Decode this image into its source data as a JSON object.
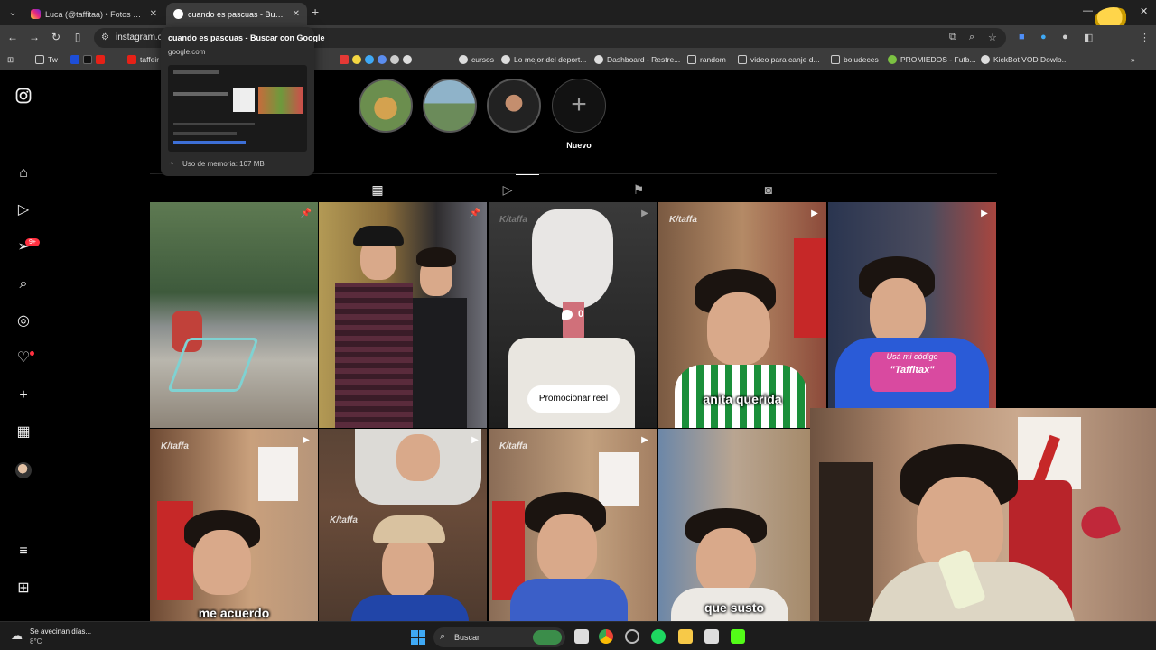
{
  "browser": {
    "tabs": [
      {
        "title": "Luca (@taffitaa) • Fotos y videos",
        "active": false
      },
      {
        "title": "cuando es pascuas - Buscar con Google",
        "active": true
      }
    ],
    "new_tab": "+",
    "address": "instagram.com",
    "tooltip": {
      "title": "cuando es pascuas - Buscar con Google",
      "host": "google.com",
      "memory": "Uso de memoria: 107 MB"
    },
    "bookmarks": [
      "Tw",
      "taffeir",
      "cursos",
      "Lo mejor del deport...",
      "Dashboard - Restre...",
      "random",
      "video para canje d...",
      "boludeces",
      "PROMIEDOS - Futb...",
      "KickBot VOD Dowlo..."
    ]
  },
  "instagram": {
    "sidebar_badge": "9+",
    "story_new_label": "Nuevo",
    "reel_comment_count": "0",
    "promo_button": "Promocionar reel",
    "watermark": "K/taffa",
    "captions": {
      "post4": "anita querida",
      "post5a": "Usá mi código",
      "post5b": "\"Taffitax\"",
      "post6": "me acuerdo",
      "post9": "que susto"
    }
  },
  "taskbar": {
    "weather_title": "Se avecinan días...",
    "weather_temp": "8°C",
    "search_label": "Buscar"
  },
  "colors": {
    "accent_red": "#ff3040",
    "chrome_dark": "#1f1f1f",
    "chrome_toolbar": "#3c3c3c"
  }
}
